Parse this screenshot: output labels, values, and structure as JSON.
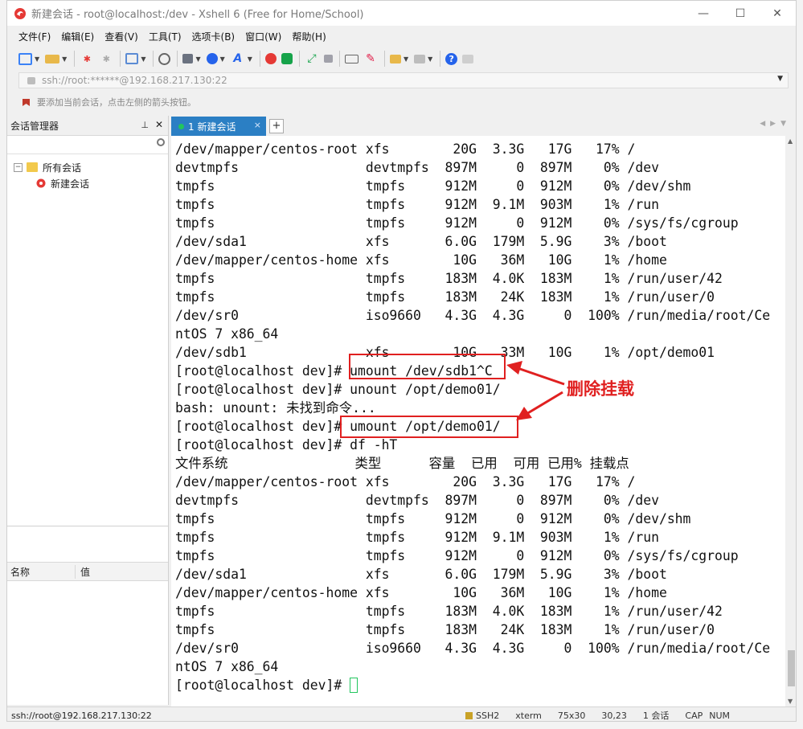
{
  "window": {
    "title": "新建会话 - root@localhost:/dev - Xshell 6 (Free for Home/School)",
    "minimize_glyph": "—",
    "maximize_glyph": "☐",
    "close_glyph": "✕"
  },
  "menu": [
    "文件(F)",
    "编辑(E)",
    "查看(V)",
    "工具(T)",
    "选项卡(B)",
    "窗口(W)",
    "帮助(H)"
  ],
  "address": {
    "text": "ssh://root:******@192.168.217.130:22"
  },
  "hint": {
    "text": "要添加当前会话，点击左侧的箭头按钮。"
  },
  "session_manager": {
    "title": "会话管理器",
    "tree": {
      "root": "所有会话",
      "child": "新建会话"
    },
    "props_headers": [
      "名称",
      "值"
    ]
  },
  "tabs": [
    {
      "label": "1 新建会话",
      "close": "×"
    }
  ],
  "terminal": {
    "lines": [
      "/dev/mapper/centos-root xfs        20G  3.3G   17G   17% /",
      "devtmpfs                devtmpfs  897M     0  897M    0% /dev",
      "tmpfs                   tmpfs     912M     0  912M    0% /dev/shm",
      "tmpfs                   tmpfs     912M  9.1M  903M    1% /run",
      "tmpfs                   tmpfs     912M     0  912M    0% /sys/fs/cgroup",
      "/dev/sda1               xfs       6.0G  179M  5.9G    3% /boot",
      "/dev/mapper/centos-home xfs        10G   36M   10G    1% /home",
      "tmpfs                   tmpfs     183M  4.0K  183M    1% /run/user/42",
      "tmpfs                   tmpfs     183M   24K  183M    1% /run/user/0",
      "/dev/sr0                iso9660   4.3G  4.3G     0  100% /run/media/root/Ce",
      "ntOS 7 x86_64",
      "/dev/sdb1               xfs        10G   33M   10G    1% /opt/demo01",
      "[root@localhost dev]# umount /dev/sdb1^C",
      "[root@localhost dev]# unount /opt/demo01/",
      "bash: unount: 未找到命令...",
      "[root@localhost dev]# umount /opt/demo01/",
      "[root@localhost dev]# df -hT",
      "文件系统                类型      容量  已用  可用 已用% 挂载点",
      "/dev/mapper/centos-root xfs        20G  3.3G   17G   17% /",
      "devtmpfs                devtmpfs  897M     0  897M    0% /dev",
      "tmpfs                   tmpfs     912M     0  912M    0% /dev/shm",
      "tmpfs                   tmpfs     912M  9.1M  903M    1% /run",
      "tmpfs                   tmpfs     912M     0  912M    0% /sys/fs/cgroup",
      "/dev/sda1               xfs       6.0G  179M  5.9G    3% /boot",
      "/dev/mapper/centos-home xfs        10G   36M   10G    1% /home",
      "tmpfs                   tmpfs     183M  4.0K  183M    1% /run/user/42",
      "tmpfs                   tmpfs     183M   24K  183M    1% /run/user/0",
      "/dev/sr0                iso9660   4.3G  4.3G     0  100% /run/media/root/Ce",
      "ntOS 7 x86_64"
    ],
    "prompt": "[root@localhost dev]# "
  },
  "annotation": {
    "label": "删除挂载",
    "color": "#e02020"
  },
  "status": {
    "left": "ssh://root@192.168.217.130:22",
    "protocol": "SSH2",
    "term": "xterm",
    "size": "75x30",
    "pos": "30,23",
    "extra": "1 会话",
    "caps": "CAP",
    "num": "NUM"
  },
  "colors": {
    "tab_active": "#2b7fc4",
    "cursor": "#22c55e",
    "annotation": "#e02020"
  }
}
